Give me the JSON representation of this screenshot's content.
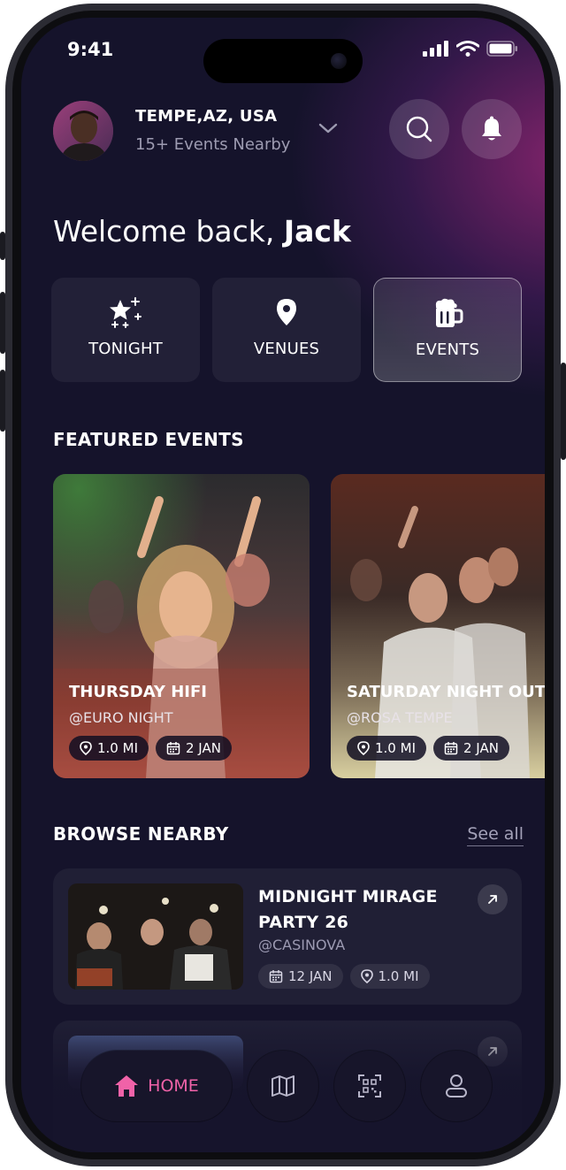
{
  "status": {
    "time": "9:41"
  },
  "header": {
    "location": "TEMPE,AZ, USA",
    "subtitle": "15+ Events Nearby"
  },
  "welcome": {
    "prefix": "Welcome back, ",
    "name": "Jack"
  },
  "categories": [
    {
      "label": "TONIGHT",
      "icon": "stars-icon"
    },
    {
      "label": "VENUES",
      "icon": "map-pin-icon"
    },
    {
      "label": "EVENTS",
      "icon": "beer-mug-icon",
      "active": true
    }
  ],
  "featured": {
    "title": "FEATURED EVENTS",
    "items": [
      {
        "title": "THURSDAY HIFI",
        "venue": "@EURO NIGHT",
        "distance": "1.0 MI",
        "date": "2 JAN"
      },
      {
        "title": "SATURDAY NIGHT OUT I",
        "venue": "@ROSA TEMPE",
        "distance": "1.0 MI",
        "date": "2 JAN"
      }
    ]
  },
  "nearby": {
    "title": "BROWSE NEARBY",
    "see_all": "See all",
    "items": [
      {
        "title_line1": "MIDNIGHT MIRAGE",
        "title_line2": "PARTY 26",
        "venue": "@CASINOVA",
        "date": "12 JAN",
        "distance": "1.0 MI"
      }
    ]
  },
  "nav": {
    "home_label": "HOME",
    "items": [
      "home-icon",
      "map-icon",
      "qr-code-icon",
      "profile-icon"
    ]
  },
  "colors": {
    "accent": "#f062a8",
    "background": "#15132b"
  }
}
